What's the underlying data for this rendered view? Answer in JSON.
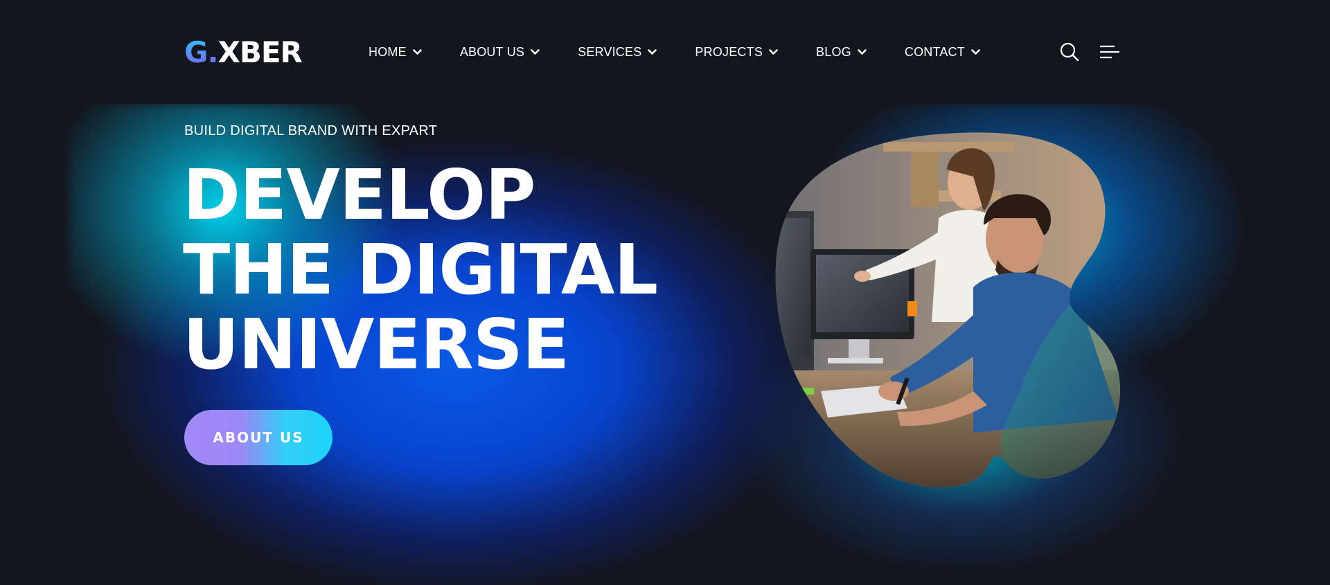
{
  "brand": {
    "logo_g": "G.",
    "logo_rest": "XBER"
  },
  "nav": {
    "items": [
      {
        "label": "HOME"
      },
      {
        "label": "ABOUT US"
      },
      {
        "label": "SERVICES"
      },
      {
        "label": "PROJECTS"
      },
      {
        "label": "BLOG"
      },
      {
        "label": "CONTACT"
      }
    ],
    "search_icon": "search-icon",
    "menu_icon": "hamburger-menu-icon"
  },
  "hero": {
    "tagline": "BUILD DIGITAL BRAND WITH EXPART",
    "headline_lines": [
      "DEVELOP",
      "THE DIGITAL",
      "UNIVERSE"
    ],
    "cta_label": "ABOUT US",
    "image_alt_icon": "team-photo"
  },
  "colors": {
    "background": "#14161f",
    "glow_cyan": "#00dcf5",
    "glow_blue": "#0a5ae6",
    "cta_gradient_start": "#a28af6",
    "cta_gradient_end": "#1dd4f8",
    "logo_gradient_start": "#2ec9f5",
    "logo_gradient_end": "#7b5df0"
  }
}
